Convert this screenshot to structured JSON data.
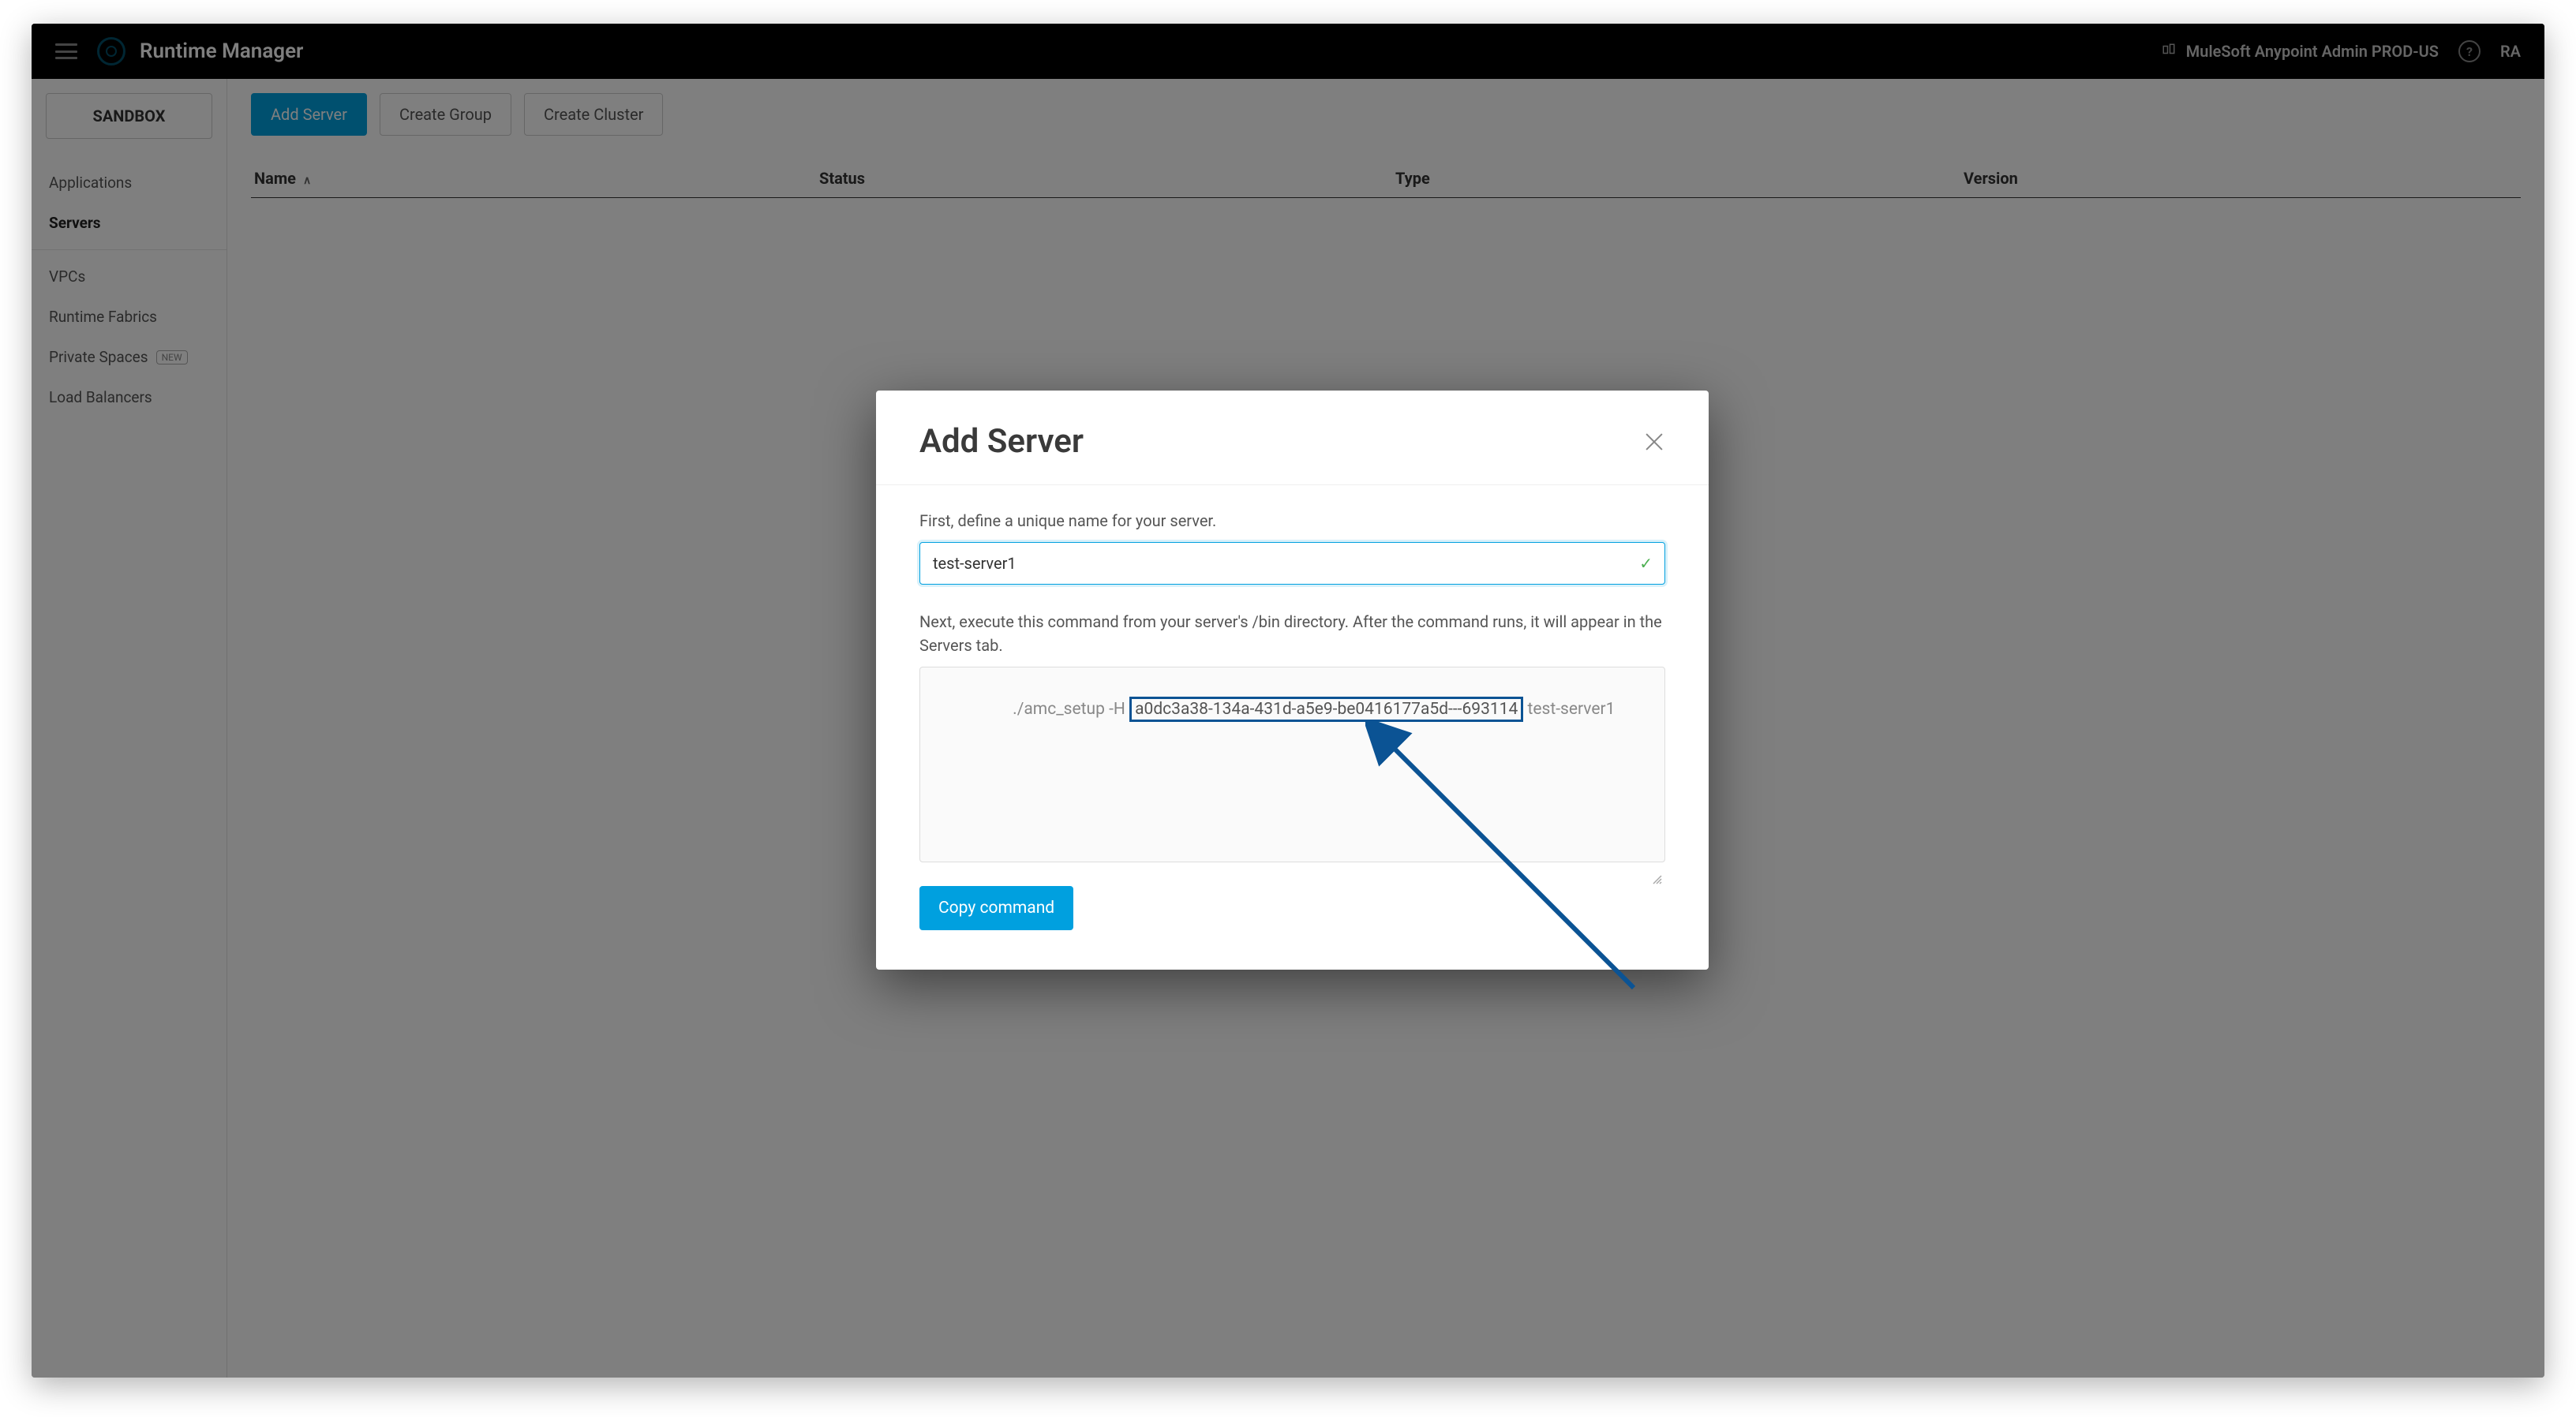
{
  "colors": {
    "primary": "#00a0df",
    "highlight_border": "#0b5394"
  },
  "topbar": {
    "app_title": "Runtime Manager",
    "org_name": "MuleSoft Anypoint Admin PROD-US",
    "help_label": "?",
    "user_initials": "RA"
  },
  "sidebar": {
    "env_label": "SANDBOX",
    "items": [
      {
        "label": "Applications",
        "active": false
      },
      {
        "label": "Servers",
        "active": true
      },
      {
        "label": "VPCs",
        "active": false
      },
      {
        "label": "Runtime Fabrics",
        "active": false
      },
      {
        "label": "Private Spaces",
        "active": false,
        "badge": "NEW"
      },
      {
        "label": "Load Balancers",
        "active": false
      }
    ]
  },
  "actions": {
    "add_server": "Add Server",
    "create_group": "Create Group",
    "create_cluster": "Create Cluster"
  },
  "table": {
    "columns": {
      "name": "Name",
      "status": "Status",
      "type": "Type",
      "version": "Version"
    },
    "sort_indicator": "∧"
  },
  "modal": {
    "title": "Add Server",
    "instruction_1": "First, define a unique name for your server.",
    "server_name_value": "test-server1",
    "instruction_2": "Next, execute this command from your server's /bin directory. After the command runs, it will appear in the Servers tab.",
    "command_prefix": "./amc_setup -H ",
    "command_token": "a0dc3a38-134a-431d-a5e9-be0416177a5d---693114",
    "command_suffix": " test-server1",
    "copy_button": "Copy command"
  }
}
